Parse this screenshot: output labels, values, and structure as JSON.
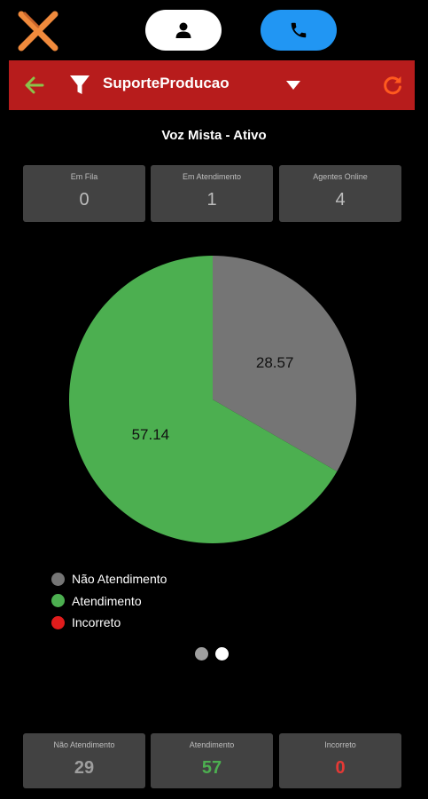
{
  "header": {
    "logo_icon": "x-logo-icon",
    "user_icon": "user-icon",
    "phone_icon": "phone-icon"
  },
  "toolbar": {
    "background": "#b71c1c",
    "back_icon": "arrow-left-icon",
    "filter_icon": "filter-icon",
    "queue_name": "SuporteProducao",
    "dropdown_icon": "caret-down-icon",
    "refresh_icon": "refresh-icon"
  },
  "title": "Voz Mista - Ativo",
  "stats_top": [
    {
      "label": "Em Fila",
      "value": "0"
    },
    {
      "label": "Em Atendimento",
      "value": "1"
    },
    {
      "label": "Agentes Online",
      "value": "4"
    }
  ],
  "chart_data": {
    "type": "pie",
    "slices": [
      {
        "name": "Não Atendimento",
        "value": 28.57,
        "color": "#757575"
      },
      {
        "name": "Atendimento",
        "value": 57.14,
        "color": "#4caf50"
      },
      {
        "name": "Incorreto",
        "value": 0,
        "color": "#e01c1c"
      }
    ],
    "start_angle_deg": 0,
    "legend_position": "bottom-left"
  },
  "legend": [
    {
      "label": "Não Atendimento",
      "color": "#757575"
    },
    {
      "label": "Atendimento",
      "color": "#4caf50"
    },
    {
      "label": "Incorreto",
      "color": "#e01c1c"
    }
  ],
  "pager": {
    "count": 2,
    "active_index": 1
  },
  "stats_bottom": [
    {
      "label": "Não Atendimento",
      "value": "29",
      "color": "#9e9e9e"
    },
    {
      "label": "Atendimento",
      "value": "57",
      "color": "#4caf50"
    },
    {
      "label": "Incorreto",
      "value": "0",
      "color": "#e53935"
    }
  ]
}
